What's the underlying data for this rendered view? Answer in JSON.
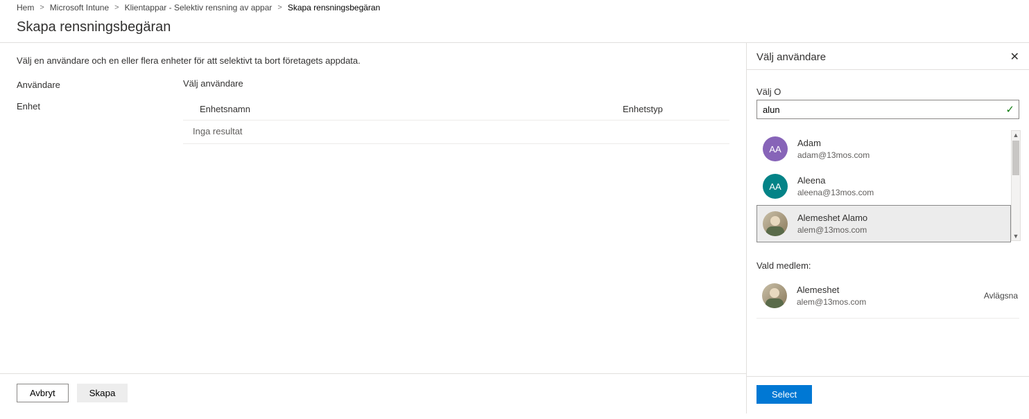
{
  "breadcrumb": {
    "items": [
      "Hem",
      "Microsoft Intune",
      "Klientappar - Selektiv rensning av appar",
      "Skapa rensningsbegäran"
    ],
    "sep": "&gt;"
  },
  "page": {
    "title": "Skapa rensningsbegäran",
    "instruction": "Välj en användare och en eller flera enheter för att selektivt ta bort företagets appdata.",
    "labels": {
      "user": "Användare",
      "device": "Enhet",
      "select_user": "Välj användare"
    },
    "device_table": {
      "col_name": "Enhetsnamn",
      "col_type": "Enhetstyp",
      "empty": "Inga resultat"
    },
    "footer": {
      "cancel": "Avbryt",
      "create": "Skapa"
    }
  },
  "panel": {
    "title": "Välj användare",
    "search_label": "Välj O",
    "search_value": "alun",
    "users": [
      {
        "initials": "AA",
        "name": "Adam",
        "email": "adam@13mos.com",
        "avatar": "purple",
        "selected": false
      },
      {
        "initials": "AA",
        "name": "Aleena",
        "email": "aleena@13mos.com",
        "avatar": "teal",
        "selected": false
      },
      {
        "initials": "",
        "name": "Alemeshet Alamo",
        "email": "alem@13mos.com",
        "avatar": "photo",
        "selected": true
      }
    ],
    "selected_label": "Vald medlem:",
    "selected_member": {
      "name": "Alemeshet",
      "email": "alem@13mos.com",
      "remove": "Avlägsna"
    },
    "select_button": "Select"
  }
}
